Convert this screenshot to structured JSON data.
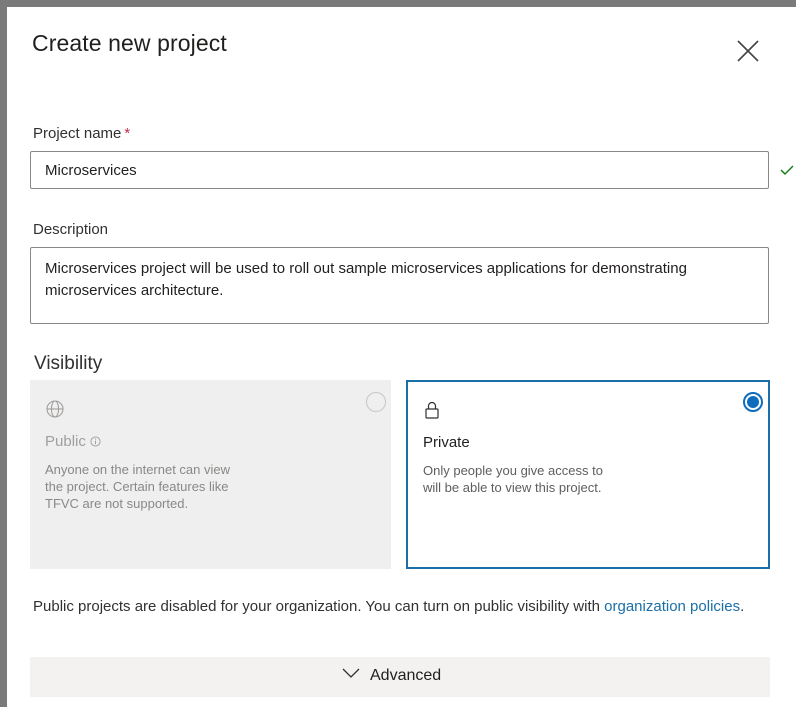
{
  "dialog": {
    "title": "Create new project"
  },
  "project_name": {
    "label": "Project name",
    "required_marker": "*",
    "value": "Microservices"
  },
  "description": {
    "label": "Description",
    "value": "Microservices project will be used to roll out sample microservices applications for demonstrating microservices architecture."
  },
  "visibility": {
    "heading": "Visibility",
    "options": [
      {
        "title": "Public",
        "description": "Anyone on the internet can view the project. Certain features like TFVC are not supported.",
        "icon": "globe-icon",
        "selected": false,
        "disabled": true
      },
      {
        "title": "Private",
        "description": "Only people you give access to will be able to view this project.",
        "icon": "lock-icon",
        "selected": true,
        "disabled": false
      }
    ],
    "notice_text": "Public projects are disabled for your organization. You can turn on public visibility with",
    "notice_link": "organization policies",
    "notice_end": "."
  },
  "advanced": {
    "label": "Advanced"
  },
  "colors": {
    "accent": "#0f6cbd",
    "selected_border": "#1a6fa8",
    "link": "#1a6fa8",
    "required": "#c4314b",
    "valid": "#107c10",
    "disabled_card": "#efefef"
  }
}
